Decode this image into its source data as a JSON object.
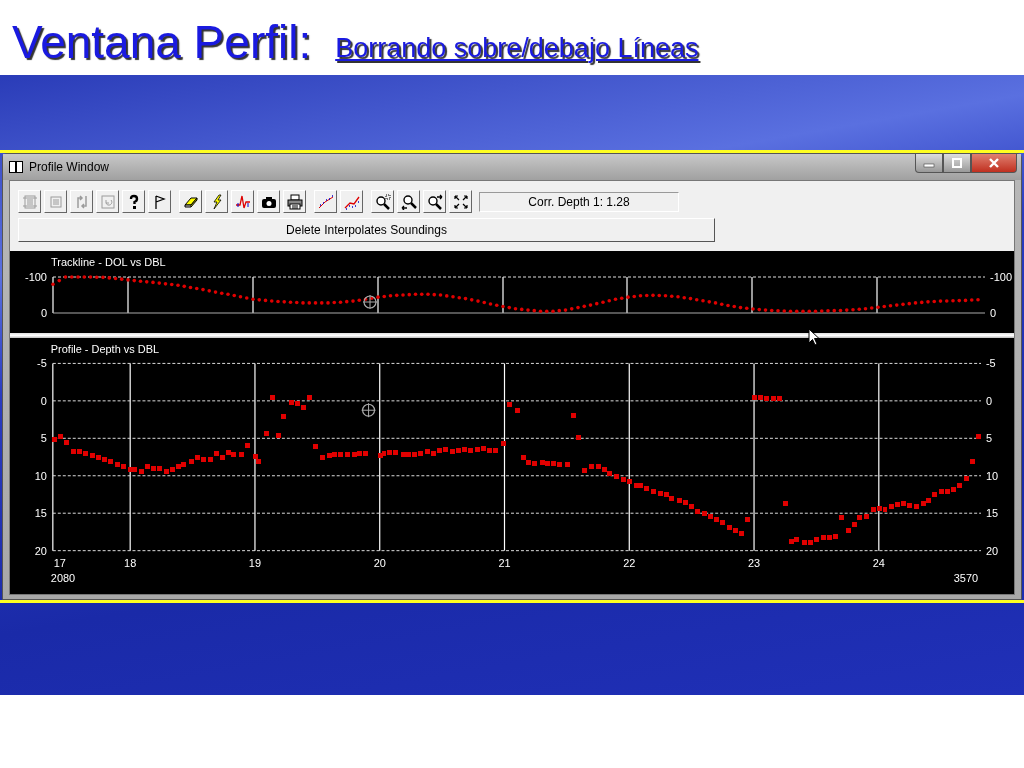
{
  "slide": {
    "title": "Ventana Perfil:",
    "subtitle": "Borrando sobre/debajo Líneas"
  },
  "window": {
    "title": "Profile Window"
  },
  "toolbar_groups": [
    [
      {
        "kind": "frame",
        "disabled": true
      },
      {
        "kind": "list",
        "disabled": true
      },
      {
        "kind": "swap",
        "disabled": true
      },
      {
        "kind": "undo",
        "disabled": true
      },
      {
        "kind": "help",
        "disabled": false
      },
      {
        "kind": "flag",
        "disabled": false
      }
    ],
    [
      {
        "kind": "eraser",
        "disabled": false
      },
      {
        "kind": "lightning",
        "disabled": false
      },
      {
        "kind": "spike",
        "disabled": false
      },
      {
        "kind": "camera",
        "disabled": false
      },
      {
        "kind": "printer",
        "disabled": false
      }
    ],
    [
      {
        "kind": "dots",
        "disabled": false
      },
      {
        "kind": "linedots",
        "disabled": false
      }
    ],
    [
      {
        "kind": "zoombox",
        "disabled": false
      },
      {
        "kind": "zoomback",
        "disabled": false
      },
      {
        "kind": "zoomnext",
        "disabled": false
      },
      {
        "kind": "fit",
        "disabled": false
      }
    ]
  ],
  "readout": "Corr. Depth 1: 1.28",
  "action_button": "Delete Interpolates Soundings",
  "trackline_panel": {
    "title": "Trackline - DOL vs DBL",
    "left_axis_labels": [
      "-100",
      "0"
    ],
    "right_axis_labels": [
      "-100",
      "0"
    ]
  },
  "profile_panel": {
    "right_axis_labels": [
      "-5",
      "0",
      "5",
      "10",
      "15",
      "20"
    ],
    "x_start_label": "17",
    "range_start": "2080",
    "range_end": "3570",
    "chart_data": {
      "type": "scatter",
      "title": "Profile - Depth vs DBL",
      "grid": true,
      "xlim": [
        17.38,
        24.82
      ],
      "ylim": [
        20,
        -5
      ],
      "yticks": [
        -5,
        0,
        5,
        10,
        15,
        20
      ],
      "xticks": [
        18,
        19,
        20,
        21,
        22,
        23,
        24
      ],
      "x": [
        17.39,
        17.44,
        17.49,
        17.54,
        17.59,
        17.64,
        17.69,
        17.74,
        17.79,
        17.84,
        17.89,
        17.94,
        18.0,
        18.04,
        18.09,
        18.14,
        18.19,
        18.24,
        18.29,
        18.34,
        18.39,
        18.43,
        18.49,
        18.54,
        18.59,
        18.64,
        18.69,
        18.74,
        18.79,
        18.83,
        18.89,
        18.94,
        19.0,
        19.03,
        19.09,
        19.14,
        19.19,
        19.23,
        19.29,
        19.34,
        19.39,
        19.43,
        19.48,
        19.54,
        19.59,
        19.63,
        19.68,
        19.74,
        19.79,
        19.83,
        19.88,
        20.0,
        20.03,
        20.08,
        20.13,
        20.19,
        20.23,
        20.28,
        20.33,
        20.38,
        20.43,
        20.48,
        20.53,
        20.58,
        20.63,
        20.68,
        20.73,
        20.78,
        20.83,
        20.88,
        20.93,
        20.99,
        21.04,
        21.1,
        21.15,
        21.19,
        21.24,
        21.3,
        21.34,
        21.39,
        21.44,
        21.5,
        21.55,
        21.59,
        21.64,
        21.69,
        21.75,
        21.8,
        21.84,
        21.89,
        21.95,
        22.0,
        22.05,
        22.09,
        22.14,
        22.2,
        22.25,
        22.3,
        22.34,
        22.4,
        22.45,
        22.5,
        22.55,
        22.6,
        22.65,
        22.7,
        22.75,
        22.8,
        22.85,
        22.9,
        22.95,
        23.0,
        23.05,
        23.1,
        23.15,
        23.2,
        23.25,
        23.3,
        23.34,
        23.4,
        23.45,
        23.5,
        23.55,
        23.6,
        23.65,
        23.7,
        23.75,
        23.8,
        23.84,
        23.9,
        23.95,
        24.0,
        24.05,
        24.1,
        24.15,
        24.2,
        24.25,
        24.3,
        24.36,
        24.4,
        24.45,
        24.5,
        24.55,
        24.6,
        24.65,
        24.7,
        24.75,
        24.8
      ],
      "series": [
        {
          "color": "#e00000",
          "values": [
            5.1,
            4.8,
            5.5,
            6.7,
            6.7,
            7.0,
            7.3,
            7.5,
            7.8,
            8.1,
            8.5,
            8.8,
            9.2,
            9.2,
            9.4,
            8.7,
            9.0,
            9.0,
            9.4,
            9.2,
            8.8,
            8.5,
            8.1,
            7.6,
            7.8,
            7.8,
            7.0,
            7.6,
            6.9,
            7.1,
            7.1,
            5.9,
            7.4,
            8.1,
            4.3,
            -0.4,
            4.6,
            2.1,
            0.2,
            0.4,
            0.9,
            -0.4,
            6.1,
            7.5,
            7.3,
            7.1,
            7.1,
            7.1,
            7.1,
            7.0,
            7.0,
            7.3,
            7.0,
            6.9,
            6.9,
            7.1,
            7.1,
            7.1,
            7.0,
            6.7,
            7.0,
            6.6,
            6.5,
            6.7,
            6.6,
            6.5,
            6.6,
            6.5,
            6.3,
            6.6,
            6.6,
            5.7,
            0.5,
            1.3,
            7.6,
            8.2,
            8.3,
            8.2,
            8.3,
            8.3,
            8.5,
            8.5,
            1.9,
            4.9,
            9.3,
            8.7,
            8.8,
            9.1,
            9.7,
            10.0,
            10.4,
            10.7,
            11.2,
            11.3,
            11.7,
            12.0,
            12.3,
            12.4,
            13.0,
            13.2,
            13.5,
            14.1,
            14.7,
            15.0,
            15.4,
            15.8,
            16.2,
            16.9,
            17.3,
            17.6,
            15.8,
            -0.4,
            -0.4,
            -0.3,
            -0.3,
            -0.3,
            13.6,
            18.7,
            18.5,
            18.8,
            18.8,
            18.5,
            18.2,
            18.2,
            18.1,
            15.5,
            17.2,
            16.4,
            15.5,
            15.4,
            14.5,
            14.3,
            14.5,
            14.1,
            13.8,
            13.7,
            13.9,
            14.1,
            13.7,
            13.3,
            12.5,
            12.1,
            12.0,
            11.8,
            11.2,
            10.3,
            8.1,
            4.7
          ]
        }
      ]
    }
  }
}
